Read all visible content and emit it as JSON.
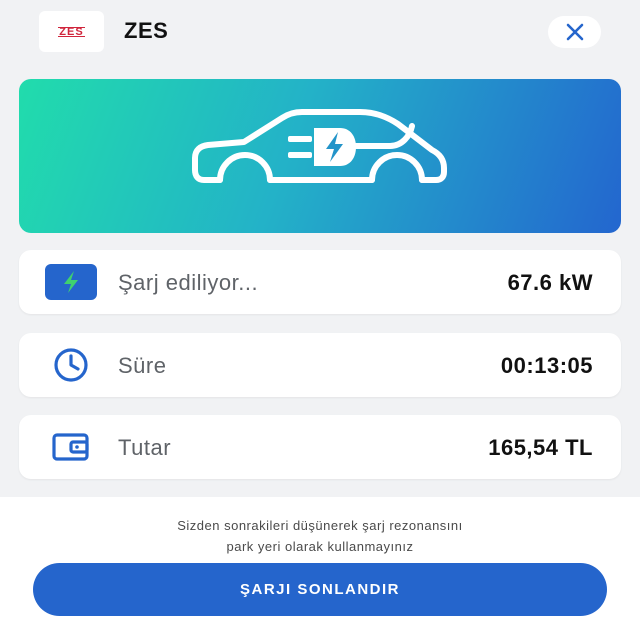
{
  "header": {
    "logo_text": "ZES",
    "title": "ZES"
  },
  "hero": {
    "icon": "electric-car-icon"
  },
  "stats": [
    {
      "icon": "bolt-icon",
      "label": "Şarj ediliyor...",
      "value": "67.6 kW"
    },
    {
      "icon": "clock-icon",
      "label": "Süre",
      "value": "00:13:05"
    },
    {
      "icon": "wallet-icon",
      "label": "Tutar",
      "value": "165,54 TL"
    }
  ],
  "footer": {
    "notice_line1": "Sizden sonrakileri düşünerek şarj rezonansını",
    "notice_line2": "park yeri olarak kullanmayınız",
    "end_button_label": "ŞARJI SONLANDIR"
  },
  "colors": {
    "accent": "#2565cc",
    "bolt_green": "#3fd16f",
    "brand_red": "#d0253c"
  }
}
